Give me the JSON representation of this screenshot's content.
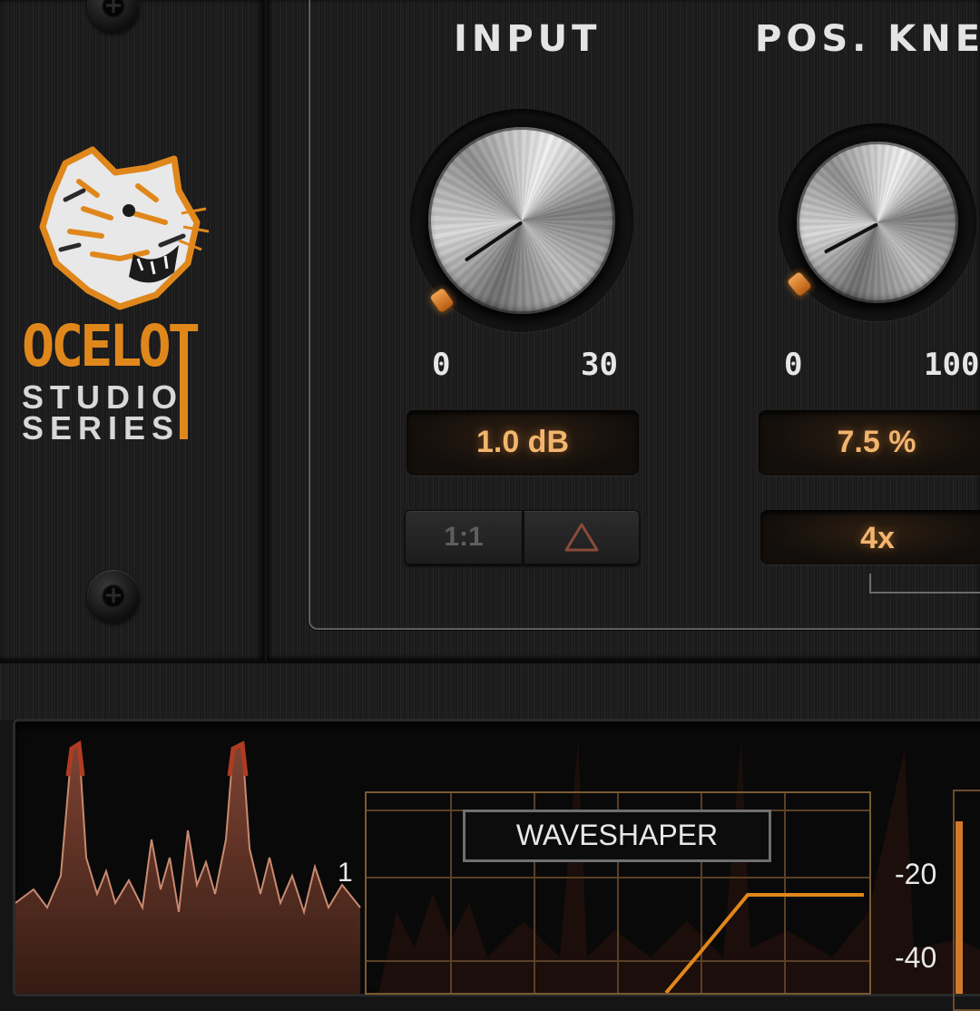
{
  "brand": {
    "name": "OCELOT",
    "line1": "STUDIO",
    "line2": "SERIES",
    "accent_color": "#e0871c",
    "logo_icon": "ocelot-head-logo"
  },
  "controls": {
    "input": {
      "label": "INPUT",
      "scale_min": "0",
      "scale_max": "30",
      "readout": "1.0 dB",
      "buttons": {
        "link_label": "1:1",
        "delta_icon": "triangle-outline-icon"
      }
    },
    "pos_knee": {
      "label": "POS. KNEE",
      "scale_min": "0",
      "scale_max": "100",
      "readout": "7.5 %",
      "oversample": "4x"
    }
  },
  "analyzer": {
    "waveshaper_title": "WAVESHAPER",
    "axis_label": "1",
    "db_labels": [
      "-20",
      "-40"
    ],
    "curve_color": "#e0871c"
  }
}
